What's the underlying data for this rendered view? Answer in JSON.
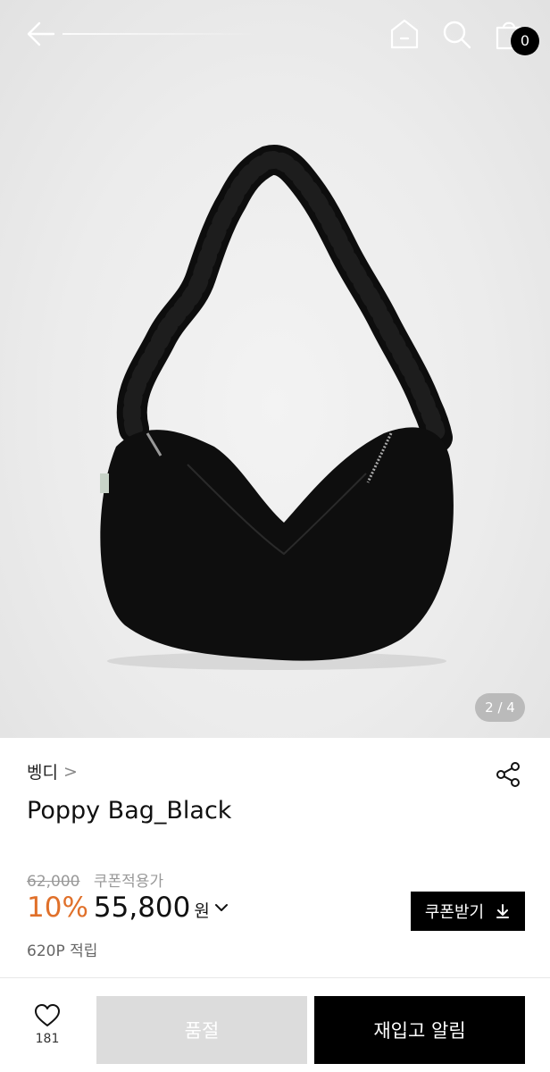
{
  "header": {
    "back_icon": "arrow-left-icon",
    "home_icon": "home-icon",
    "search_icon": "search-icon",
    "cart_icon": "shopping-bag-icon",
    "cart_count": "0"
  },
  "gallery": {
    "image_subject": "black ruched-strap shoulder bag",
    "current": "2",
    "total": "4",
    "counter_label": "2 / 4"
  },
  "product": {
    "brand": "벵디",
    "brand_chevron": ">",
    "share_icon": "share-icon",
    "name": "Poppy Bag_Black",
    "original_price": "62,000",
    "coupon_price_label": "쿠폰적용가",
    "discount": "10%",
    "sale_price": "55,800",
    "currency": "원",
    "points": "620P 적립",
    "coupon_button": "쿠폰받기",
    "discount_color": "#e0702a"
  },
  "bottom_bar": {
    "wishlist_count": "181",
    "soldout_label": "품절",
    "restock_label": "재입고 알림"
  }
}
